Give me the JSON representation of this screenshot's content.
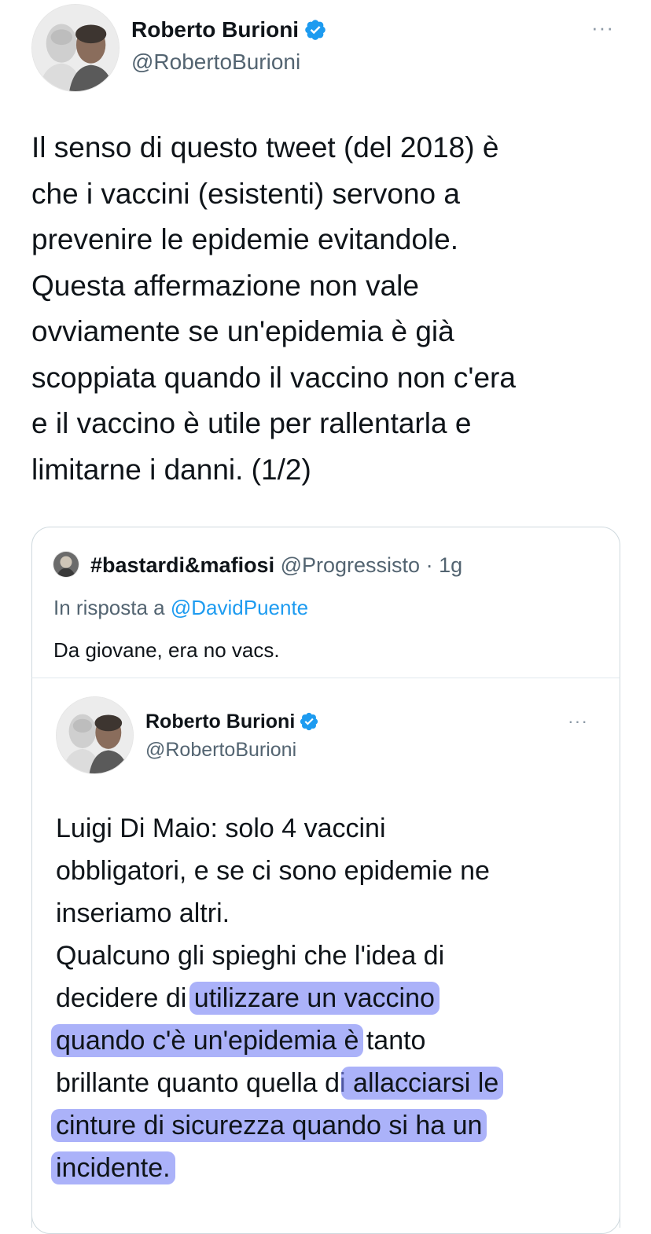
{
  "main_tweet": {
    "author_name": "Roberto Burioni",
    "author_handle": "@RobertoBurioni",
    "avatar_icon": "avatar-photo-icon",
    "verified_icon": "verified-badge-icon",
    "more_icon": "more-options-icon",
    "more_label": "···",
    "text": "Il senso di questo tweet (del 2018) è\nche i vaccini (esistenti) servono a\nprevenire le epidemie evitandole.\nQuesta affermazione non vale\novviamente se un'epidemia è già\nscoppiata quando il vaccino non c'era\ne il vaccino è utile per rallentarla e\nlimitarne i danni. (1/2)"
  },
  "quoted_reply": {
    "author_name": "#bastardi&mafiosi",
    "author_handle": "@Progressisto",
    "separator": "·",
    "time": "1g",
    "reply_prefix": "In risposta a",
    "reply_to": "@DavidPuente",
    "text": "Da giovane, era no vacs."
  },
  "embedded_tweet": {
    "author_name": "Roberto Burioni",
    "author_handle": "@RobertoBurioni",
    "more_label": "···",
    "lines": [
      {
        "plain": "Luigi Di Maio: solo 4 vaccini"
      },
      {
        "plain": "obbligatori, e se ci sono epidemie ne"
      },
      {
        "plain": "inseriamo altri."
      },
      {
        "plain": "Qualcuno gli spieghi che l'idea di"
      },
      {
        "before": "decidere di ",
        "highlight": "utilizzare un vaccino"
      },
      {
        "highlight": "quando c'è un'epidemia è",
        "after": " tanto"
      },
      {
        "before": "brillante quanto quella di",
        "highlight": " allacciarsi le"
      },
      {
        "highlight": "cinture di sicurezza quando si ha un"
      },
      {
        "highlight": "incidente."
      }
    ],
    "highlight_color": "#7882f5"
  },
  "colors": {
    "text": "#0f1419",
    "secondary": "#536471",
    "link": "#1d9bf0",
    "verified": "#1d9bf0",
    "border": "#cfd9de"
  }
}
